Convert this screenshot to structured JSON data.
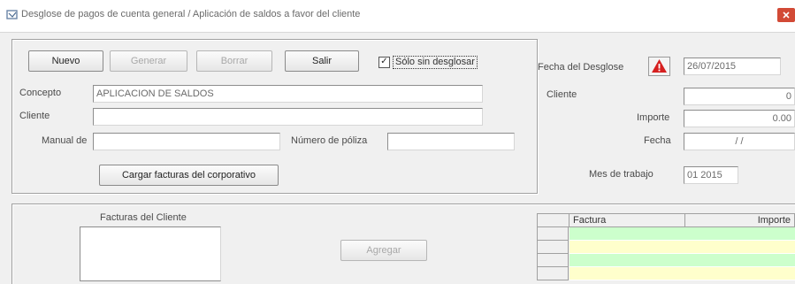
{
  "window": {
    "title": "Desglose de pagos de cuenta general / Aplicación de saldos a favor del cliente",
    "icon": "app-icon",
    "close_icon": "close-icon",
    "close_color": "#d24a36"
  },
  "toolbar": {
    "nuevo": "Nuevo",
    "generar": "Generar",
    "borrar": "Borrar",
    "salir": "Salir",
    "solo_sin_desglose": {
      "label": "Sólo sin desglosar",
      "checked": true,
      "check_glyph": "✓"
    }
  },
  "form": {
    "concepto_label": "Concepto",
    "concepto_value": "APLICACION DE SALDOS",
    "cliente_label": "Cliente",
    "cliente_value": "",
    "manual_label": "Manual de",
    "manual_value": "",
    "numero_poliza_label": "Número de póliza",
    "numero_poliza_value": "",
    "cargar_facturas_button": "Cargar facturas del corporativo"
  },
  "right_panel": {
    "fecha_desglose_label": "Fecha del Desglose",
    "fecha_desglose_value": "26/07/2015",
    "warning_icon": "warning-icon",
    "warning_color": "#d62020",
    "cliente_label": "Cliente",
    "cliente_value": "0",
    "importe_label": "Importe",
    "importe_value": "0.00",
    "fecha_label": "Fecha",
    "fecha_value": "/ /",
    "mes_trabajo_label": "Mes de trabajo",
    "mes_trabajo_value": "01 2015"
  },
  "bottom": {
    "facturas_cliente_label": "Facturas del Cliente",
    "agregar_button": "Agregar",
    "grid": {
      "columns": [
        "Factura",
        "Importe"
      ],
      "row_colors": [
        "#ccffcc",
        "#ffffcc",
        "#ccffcc",
        "#ffffcc"
      ]
    }
  }
}
